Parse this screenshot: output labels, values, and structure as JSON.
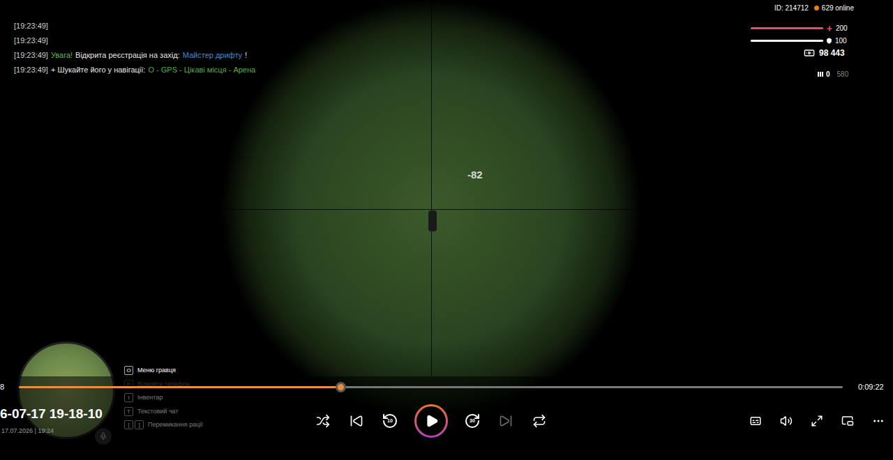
{
  "chat": [
    {
      "segments": [
        {
          "text": "[19:23:49]",
          "color": "#cfcfcf"
        }
      ]
    },
    {
      "segments": [
        {
          "text": "[19:23:49]",
          "color": "#cfcfcf"
        }
      ]
    },
    {
      "segments": [
        {
          "text": "[19:23:49]",
          "color": "#cfcfcf"
        },
        {
          "text": "Увага!",
          "color": "#5fbf3a"
        },
        {
          "text": "Відкрита реєстрація на захід:",
          "color": "#e8e8e8"
        },
        {
          "text": "Майстер дрифту",
          "color": "#3b8fd9"
        },
        {
          "text": "!",
          "color": "#e8e8e8"
        }
      ]
    },
    {
      "segments": [
        {
          "text": "[19:23:49]",
          "color": "#cfcfcf"
        },
        {
          "text": "+ Шукайте його у навігації:",
          "color": "#e8e8e8"
        },
        {
          "text": "O - GPS - Цікаві місця - Арена",
          "color": "#4fae48"
        }
      ]
    }
  ],
  "hud": {
    "id": "ID: 214712",
    "online": "629 online",
    "health": {
      "value": "200",
      "level": 1
    },
    "armour": {
      "value": "100",
      "level": 1
    },
    "money": "98 443",
    "ammo": {
      "clip": "0",
      "total": "580"
    }
  },
  "hit_marker": "-82",
  "hints": [
    {
      "keys": [
        "O"
      ],
      "label": "Меню гравця",
      "covered": false
    },
    {
      "keys": [
        "P"
      ],
      "label": "Відкрити телефон",
      "covered": true
    },
    {
      "keys": [
        "I"
      ],
      "label": "Інвентар",
      "covered": false
    },
    {
      "keys": [
        "T"
      ],
      "label": "Текстовий чат",
      "covered": false
    },
    {
      "keys": [
        "[",
        "]"
      ],
      "label": "Перемикання рації",
      "covered": false
    }
  ],
  "player": {
    "elapsed": "8",
    "duration": "0:09:22",
    "level": 0.39,
    "title": "6-07-17 19-18-10",
    "subtitle": "17.07.2026 | 19:24",
    "playing": false,
    "controls": [
      {
        "kind": "shuffle",
        "badge": "",
        "disabled": false
      },
      {
        "kind": "previous",
        "badge": "",
        "disabled": false
      },
      {
        "kind": "rewind",
        "badge": "10",
        "disabled": false
      },
      {
        "kind": "play",
        "badge": "",
        "disabled": false
      },
      {
        "kind": "forward",
        "badge": "30",
        "disabled": false
      },
      {
        "kind": "next",
        "badge": "",
        "disabled": true
      },
      {
        "kind": "repeat",
        "badge": "",
        "disabled": false
      }
    ],
    "tools": [
      {
        "kind": "subtitles"
      },
      {
        "kind": "volume"
      },
      {
        "kind": "fullscreen"
      },
      {
        "kind": "pip"
      },
      {
        "kind": "more"
      }
    ]
  }
}
